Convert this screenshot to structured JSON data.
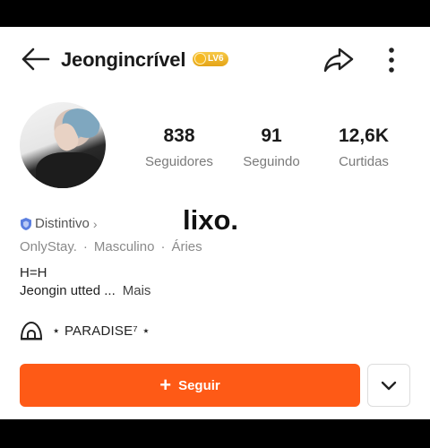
{
  "header": {
    "username": "Jeongincrível",
    "level_badge": "LV6",
    "icons": [
      "back-arrow-icon",
      "share-icon",
      "more-icon"
    ]
  },
  "stats": [
    {
      "value": "838",
      "label": "Seguidores"
    },
    {
      "value": "91",
      "label": "Seguindo"
    },
    {
      "value": "12,6K",
      "label": "Curtidas"
    }
  ],
  "badge_link": "Distintivo",
  "overlay_text": "lixo.",
  "meta": [
    "OnlyStay.",
    "Masculino",
    "Áries"
  ],
  "meta_separator": "·",
  "bio": {
    "line1": "H=H",
    "line2": "Jeongin utted ...",
    "more": "Mais"
  },
  "community": "⋆ PARADISE⁷ ⋆",
  "actions": {
    "follow_label": "Seguir"
  },
  "colors": {
    "accent": "#fe5a16",
    "badge": "#f5b822",
    "shield": "#5b7fe0"
  }
}
